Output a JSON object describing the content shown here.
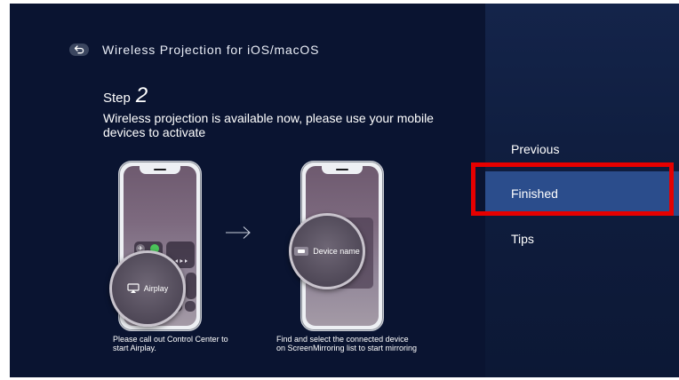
{
  "header": {
    "title": "Wireless Projection for iOS/macOS",
    "back_icon": "back-arrow-icon"
  },
  "step": {
    "label": "Step",
    "number": "2",
    "description": "Wireless projection is available now, please use your mobile devices to activate"
  },
  "illustrations": {
    "left_phone": {
      "bubble_label": "Airplay",
      "caption": "Please call out Control Center to start Airplay."
    },
    "right_phone": {
      "bubble_label": "Device name",
      "caption": "Find and select the connected device on ScreenMirroring list to start mirroring"
    }
  },
  "menu": {
    "items": [
      {
        "label": "Previous"
      },
      {
        "label": "Finished"
      },
      {
        "label": "Tips"
      }
    ],
    "selected": "Finished"
  },
  "colors": {
    "background": "#0a1431",
    "side_panel": "#14244a",
    "selected_item": "#2b4d8c",
    "highlight_border": "#e60000"
  }
}
